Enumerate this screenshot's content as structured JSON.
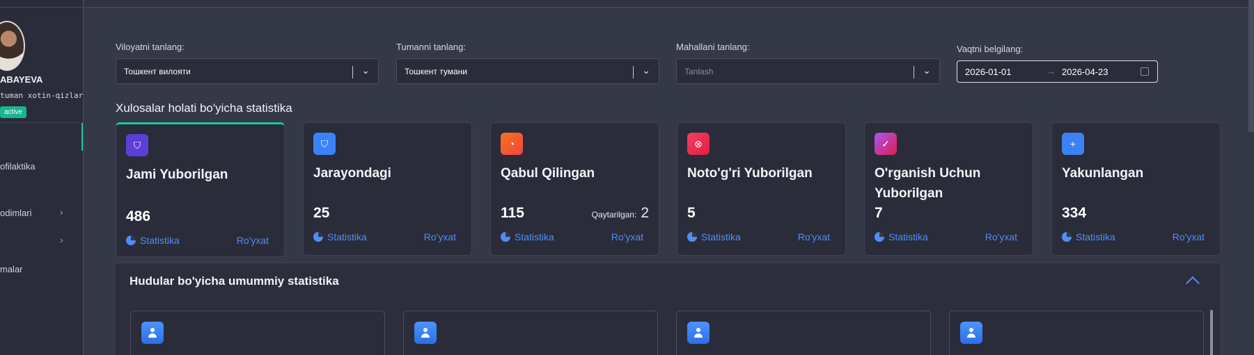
{
  "sidebar": {
    "user_name": "ABAYEVA",
    "user_role": "tuman xotin-qizlar",
    "status_badge": "active",
    "items": [
      {
        "label": "ofilaktika"
      },
      {
        "label": "odimlari"
      },
      {
        "label": ""
      },
      {
        "label": "malar"
      }
    ]
  },
  "filters": {
    "region": {
      "label": "Viloyatni tanlang:",
      "value": "Тошкент вилояти"
    },
    "district": {
      "label": "Tumanni tanlang:",
      "value": "Тошкент тумани"
    },
    "mahalla": {
      "label": "Mahallani tanlang:",
      "placeholder": "Tanlash"
    },
    "date": {
      "label": "Vaqtni belgilang:",
      "start": "2026-01-01",
      "arrow": "→",
      "end": "2026-04-23"
    }
  },
  "stats_section_title": "Xulosalar holati bo'yicha statistika",
  "cards": [
    {
      "title": "Jami Yuborilgan",
      "value": "486",
      "icon": "shield-icon",
      "color": "#5b3fd6"
    },
    {
      "title": "Jarayondagi",
      "value": "25",
      "icon": "shield-icon",
      "color": "#3b82f6"
    },
    {
      "title": "Qabul Qilingan",
      "value": "115",
      "returned_label": "Qaytarilgan:",
      "returned_value": "2",
      "icon": "compass-icon",
      "color": "#ef4444"
    },
    {
      "title": "Noto'g'ri Yuborilgan",
      "value": "5",
      "icon": "x-circle-icon",
      "color": "#e53950"
    },
    {
      "title": "O'rganish Uchun Yuborilgan",
      "value": "7",
      "icon": "shield-check-icon",
      "color": "#d6336c"
    },
    {
      "title": "Yakunlangan",
      "value": "334",
      "icon": "shield-plus-icon",
      "color": "#3b82f6"
    }
  ],
  "card_links": {
    "stat": "Statistika",
    "list": "Ro'yxat"
  },
  "regions_panel": {
    "title": "Hudular bo'yicha umummiy statistika",
    "region_cards": [
      {
        "icon": "user-icon"
      },
      {
        "icon": "user-icon"
      },
      {
        "icon": "user-icon"
      },
      {
        "icon": "user-icon"
      }
    ]
  }
}
